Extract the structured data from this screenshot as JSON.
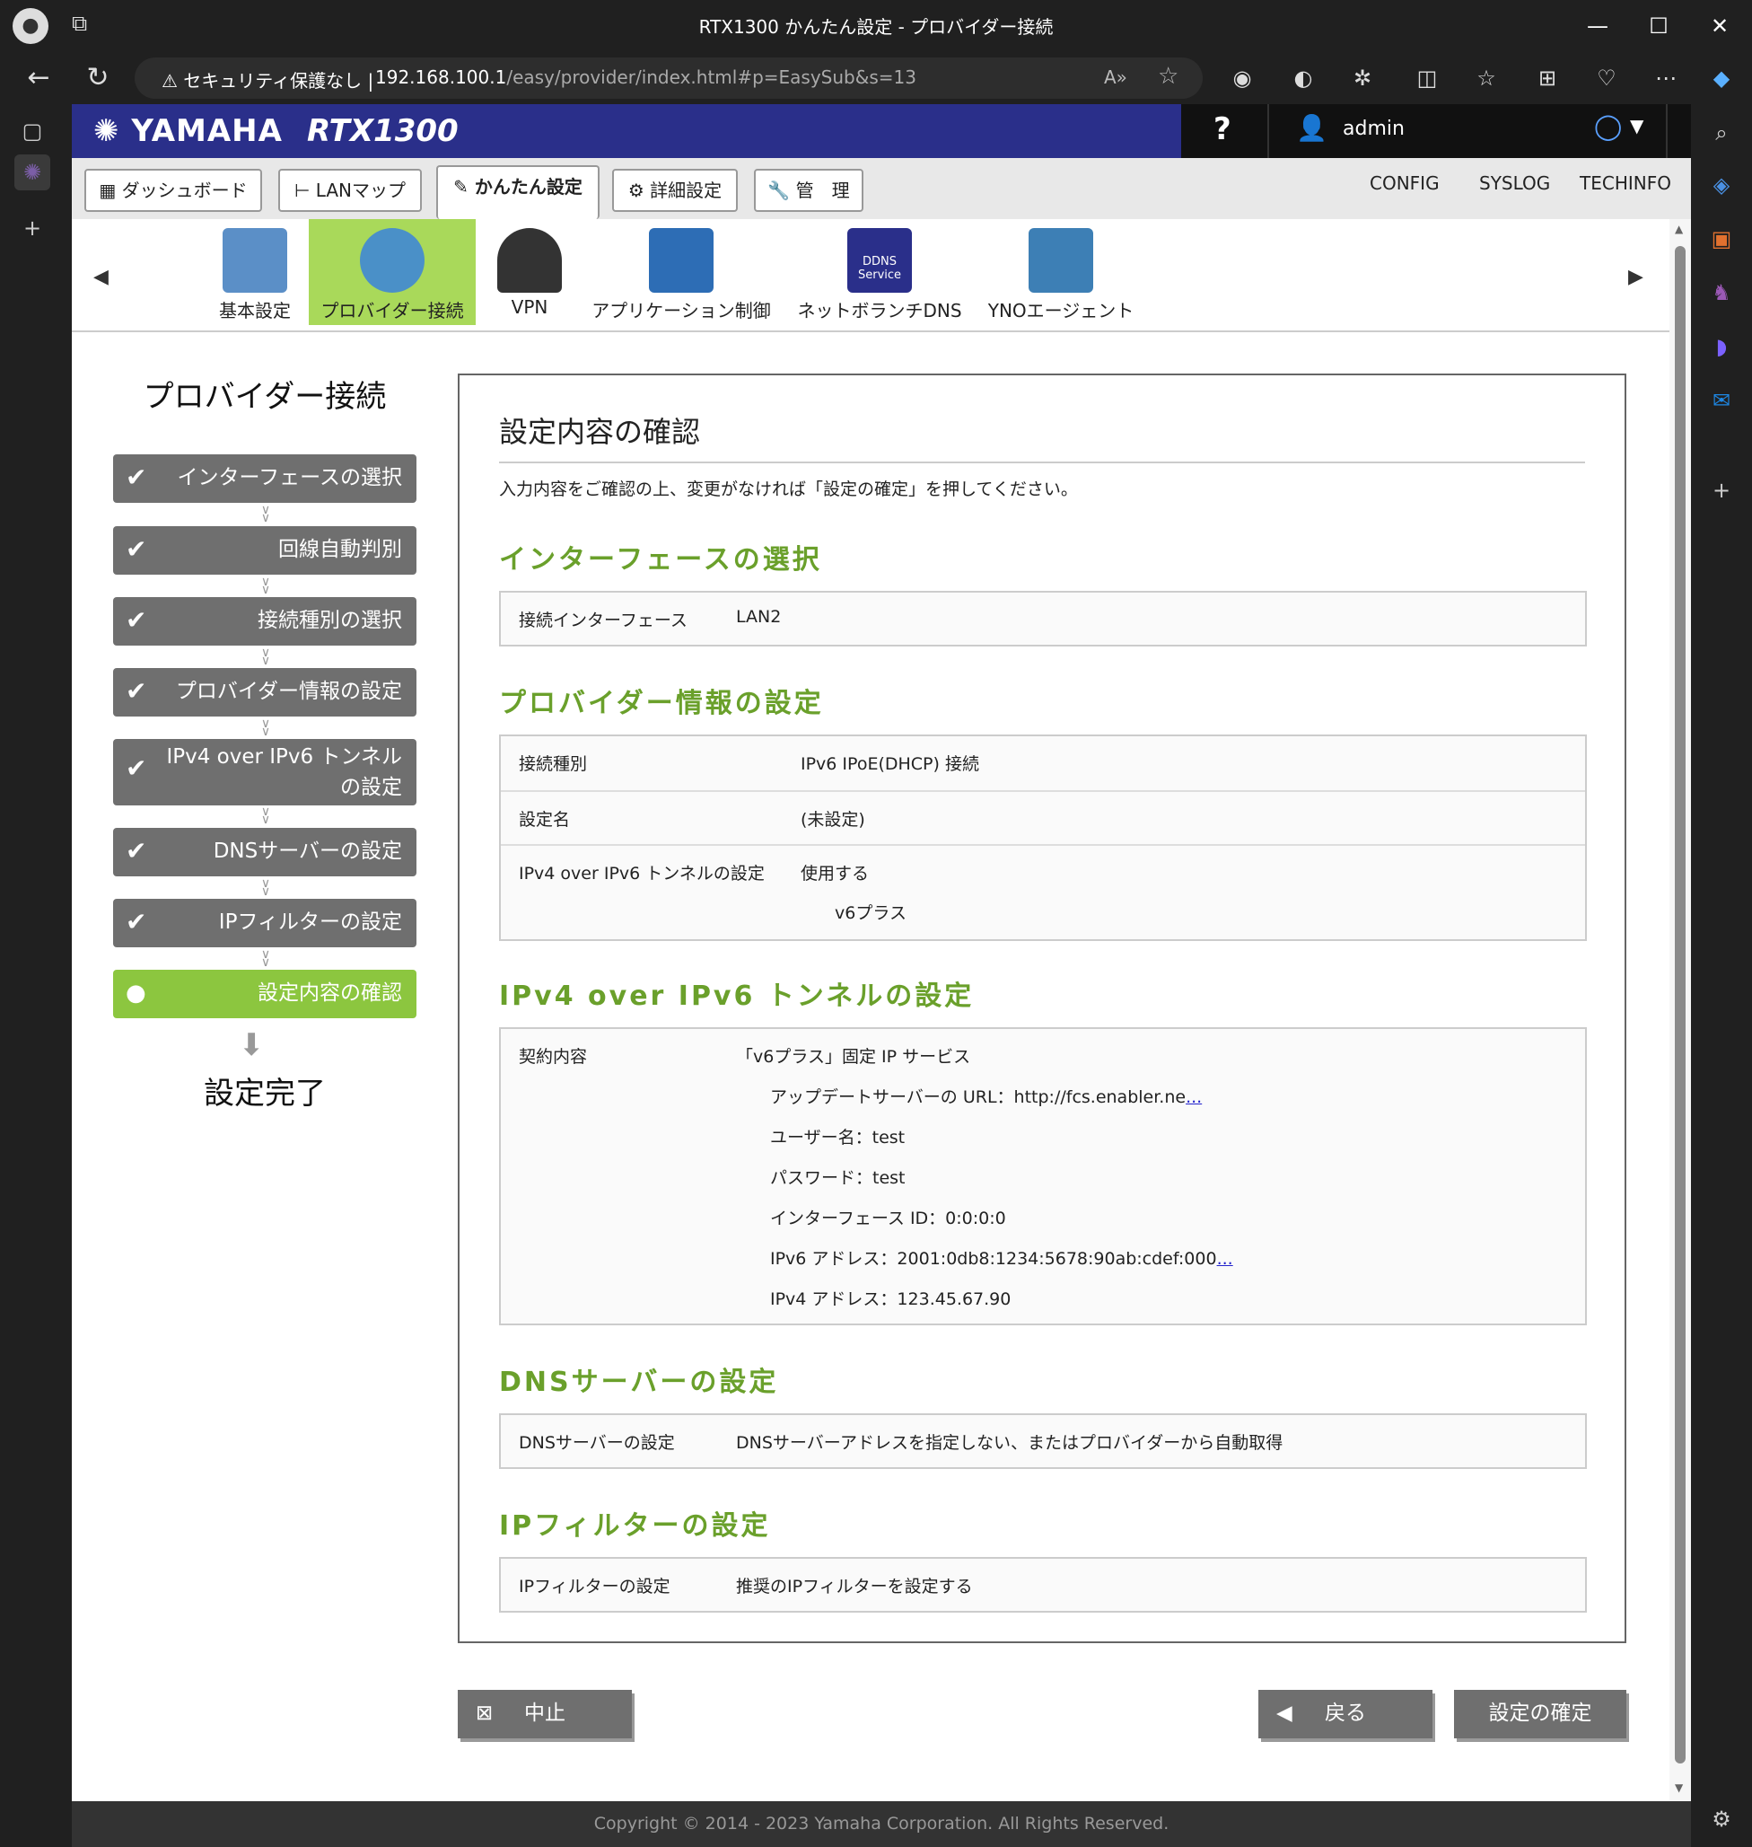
{
  "browser": {
    "title": "RTX1300 かんたん設定 - プロバイダー接続",
    "security": "セキュリティ保護なし",
    "url_host": "192.168.100.1",
    "url_path": "/easy/provider/index.html#p=EasySub&s=13"
  },
  "header": {
    "logo": "YAMAHA",
    "model": "RTX1300",
    "help": "?",
    "user": "admin"
  },
  "tabs": [
    "ダッシュボード",
    "LANマップ",
    "かんたん設定",
    "詳細設定",
    "管　理"
  ],
  "toplinks": [
    "CONFIG",
    "SYSLOG",
    "TECHINFO"
  ],
  "apps": [
    "基本設定",
    "プロバイダー接続",
    "VPN",
    "アプリケーション制御",
    "ネットボランチDNS",
    "YNOエージェント"
  ],
  "ddns_icon_text": "DDNS Service",
  "sidebar": {
    "title": "プロバイダー接続",
    "steps": [
      "インターフェースの選択",
      "回線自動判別",
      "接続種別の選択",
      "プロバイダー情報の設定",
      "IPv4 over IPv6 トンネル",
      "の設定",
      "DNSサーバーの設定",
      "IPフィルターの設定",
      "設定内容の確認"
    ],
    "done": "設定完了"
  },
  "main": {
    "title": "設定内容の確認",
    "intro": "入力内容をご確認の上、変更がなければ「設定の確定」を押してください。",
    "sec1": {
      "head": "インターフェースの選択",
      "label": "接続インターフェース",
      "value": "LAN2"
    },
    "sec2": {
      "head": "プロバイダー情報の設定",
      "r1l": "接続種別",
      "r1v": "IPv6 IPoE(DHCP) 接続",
      "r2l": "設定名",
      "r2v": "(未設定)",
      "r3l": "IPv4 over IPv6 トンネルの設定",
      "r3v": "使用する",
      "r3v2": "v6プラス"
    },
    "sec3": {
      "head": "IPv4 over IPv6 トンネルの設定",
      "label": "契約内容",
      "v0": "「v6プラス」固定 IP サービス",
      "v1": "アップデートサーバーの URL：http://fcs.enabler.ne",
      "v2": "ユーザー名：test",
      "v3": "パスワード：test",
      "v4": "インターフェース ID：0:0:0:0",
      "v5": "IPv6 アドレス：2001:0db8:1234:5678:90ab:cdef:000",
      "v6": "IPv4 アドレス：123.45.67.90",
      "more": "..."
    },
    "sec4": {
      "head": "DNSサーバーの設定",
      "label": "DNSサーバーの設定",
      "value": "DNSサーバーアドレスを指定しない、またはプロバイダーから自動取得"
    },
    "sec5": {
      "head": "IPフィルターの設定",
      "label": "IPフィルターの設定",
      "value": "推奨のIPフィルターを設定する"
    }
  },
  "buttons": {
    "cancel": "中止",
    "back": "戻る",
    "confirm": "設定の確定"
  },
  "footer": "Copyright © 2014 - 2023 Yamaha Corporation. All Rights Reserved."
}
